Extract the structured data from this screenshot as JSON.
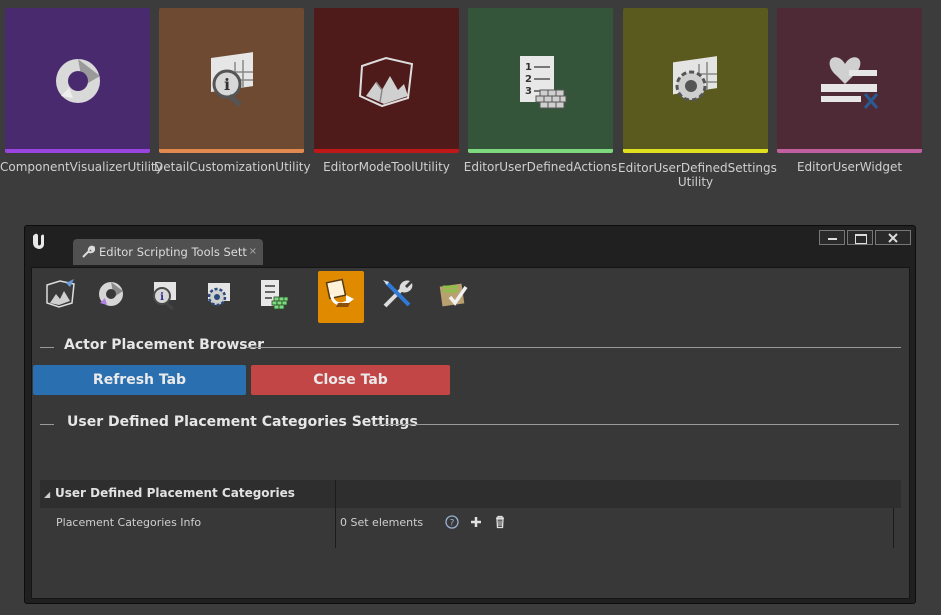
{
  "tiles": [
    {
      "label": "ComponentVisualizerUtility",
      "bg": "#4a2a6e",
      "stripe": "#9a44e0",
      "icon": "component-visualizer-icon"
    },
    {
      "label": "DetailCustomizationUtility",
      "bg": "#6e4a32",
      "stripe": "#e08a50",
      "icon": "detail-customization-icon"
    },
    {
      "label": "EditorModeToolUtility",
      "bg": "#4e1a1a",
      "stripe": "#c01818",
      "icon": "editor-mode-tool-icon"
    },
    {
      "label": "EditorUserDefinedActions",
      "bg": "#35553a",
      "stripe": "#7ed87e",
      "icon": "user-defined-actions-icon"
    },
    {
      "label_line1": "EditorUserDefinedSettings",
      "label_line2": "Utility",
      "bg": "#5a5a1e",
      "stripe": "#e0e020",
      "icon": "user-defined-settings-icon"
    },
    {
      "label": "EditorUserWidget",
      "bg": "#4e2a36",
      "stripe": "#c060a0",
      "icon": "user-widget-icon"
    }
  ],
  "window": {
    "tab_title": "Editor Scripting Tools Sett",
    "tab_close": "×",
    "toolbar": [
      {
        "icon": "editor-mode-tool-icon",
        "active": false
      },
      {
        "icon": "component-visualizer-icon",
        "active": false
      },
      {
        "icon": "detail-customization-icon",
        "active": false
      },
      {
        "icon": "user-defined-settings-icon",
        "active": false
      },
      {
        "icon": "user-defined-actions-icon",
        "active": false
      },
      {
        "icon": "actor-placement-icon",
        "active": true
      },
      {
        "icon": "tools-icon",
        "active": false
      },
      {
        "icon": "checklist-icon",
        "active": false
      }
    ],
    "section1_title": "Actor Placement Browser",
    "refresh_label": "Refresh Tab",
    "close_label": "Close Tab",
    "section2_title": "User Defined Placement Categories Settings",
    "category_label": "User Defined Placement Categories",
    "property_name": "Placement Categories Info",
    "property_value": "0 Set elements"
  }
}
